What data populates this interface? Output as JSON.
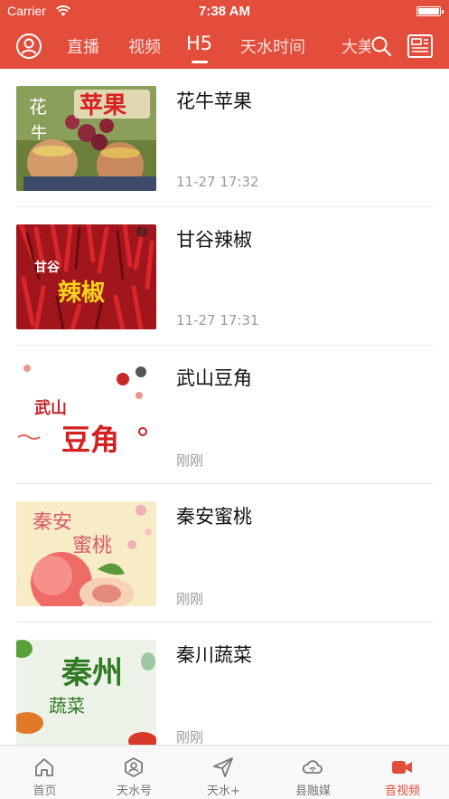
{
  "status_bar": {
    "carrier": "Carrier",
    "time": "7:38 AM"
  },
  "nav": {
    "tabs": [
      {
        "label": "直播"
      },
      {
        "label": "视频"
      },
      {
        "label": "H5"
      },
      {
        "label": "天水时间"
      },
      {
        "label": "大美"
      }
    ],
    "active_tab": "H5",
    "icons": [
      "user-icon",
      "search-icon",
      "news-icon"
    ]
  },
  "items": [
    {
      "title": "花牛苹果",
      "time": "11-27  17:32",
      "thumb_text": [
        "花",
        "牛",
        "苹果"
      ]
    },
    {
      "title": "甘谷辣椒",
      "time": "11-27  17:31",
      "thumb_text": [
        "甘谷",
        "辣椒"
      ]
    },
    {
      "title": "武山豆角",
      "time": "刚刚",
      "thumb_text": [
        "武山",
        "豆角"
      ]
    },
    {
      "title": "秦安蜜桃",
      "time": "刚刚",
      "thumb_text": [
        "秦安",
        "蜜桃"
      ]
    },
    {
      "title": "秦川蔬菜",
      "time": "刚刚",
      "thumb_text": [
        "秦州",
        "蔬菜"
      ]
    }
  ],
  "tabbar": [
    {
      "label": "首页",
      "icon": "home-icon"
    },
    {
      "label": "天水号",
      "icon": "hexagon-user-icon"
    },
    {
      "label": "天水+",
      "icon": "send-icon"
    },
    {
      "label": "县融媒",
      "icon": "cloud-signal-icon"
    },
    {
      "label": "音视频",
      "icon": "video-camera-icon",
      "active": true
    }
  ],
  "colors": {
    "brand": "#e24d3c",
    "active_tab": "#e24d3c",
    "inactive_tab": "#777777"
  }
}
